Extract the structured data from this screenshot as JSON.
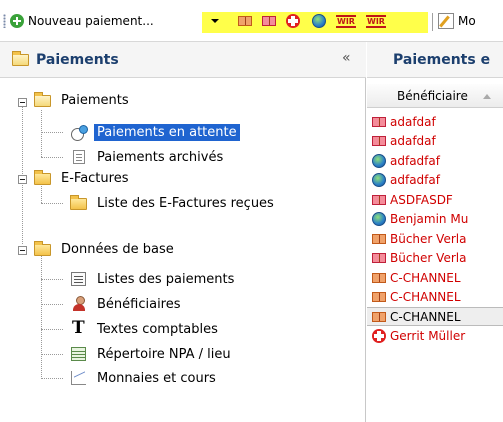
{
  "toolbar": {
    "new_payment_label": "Nouveau paiement...",
    "wir_label_1": "WIR",
    "wir_label_2": "WIR",
    "edit_label_partial": "Mo"
  },
  "left_panel": {
    "title": "Paiements",
    "collapse_glyph": "«",
    "tree": {
      "paiements": "Paiements",
      "paiements_en_attente": "Paiements en attente",
      "paiements_archives": "Paiements archivés",
      "efactures": "E-Factures",
      "liste_efactures": "Liste des E-Factures reçues",
      "donnees_de_base": "Données de base",
      "listes_paiements": "Listes des paiements",
      "beneficiaires": "Bénéficiaires",
      "textes_comptables": "Textes comptables",
      "repertoire_npa": "Répertoire NPA / lieu",
      "monnaies_cours": "Monnaies et cours"
    }
  },
  "right_panel": {
    "title": "Paiements e",
    "column_header": "Bénéficiaire",
    "rows": [
      {
        "text": "adafdaf",
        "icon": "book-red-icon"
      },
      {
        "text": "adafdaf",
        "icon": "book-red-icon"
      },
      {
        "text": "adfadfaf",
        "icon": "globe-icon"
      },
      {
        "text": "adfadfaf",
        "icon": "globe-icon"
      },
      {
        "text": "ASDFASDF",
        "icon": "book-red-icon"
      },
      {
        "text": "Benjamin Mu",
        "icon": "globe-icon"
      },
      {
        "text": "Bücher Verla",
        "icon": "book-orange-icon"
      },
      {
        "text": "Bücher Verla",
        "icon": "book-red-icon"
      },
      {
        "text": "C-CHANNEL",
        "icon": "book-orange-icon"
      },
      {
        "text": "C-CHANNEL",
        "icon": "book-orange-icon"
      },
      {
        "text": "C-CHANNEL",
        "icon": "book-orange-icon"
      },
      {
        "text": "Gerrit Müller",
        "icon": "swiss-cross-icon"
      }
    ]
  },
  "colors": {
    "selection": "#1f64d0",
    "toolbar_highlight": "#ffff4a",
    "row_text": "#d00000",
    "panel_title": "#1c3f6e"
  }
}
